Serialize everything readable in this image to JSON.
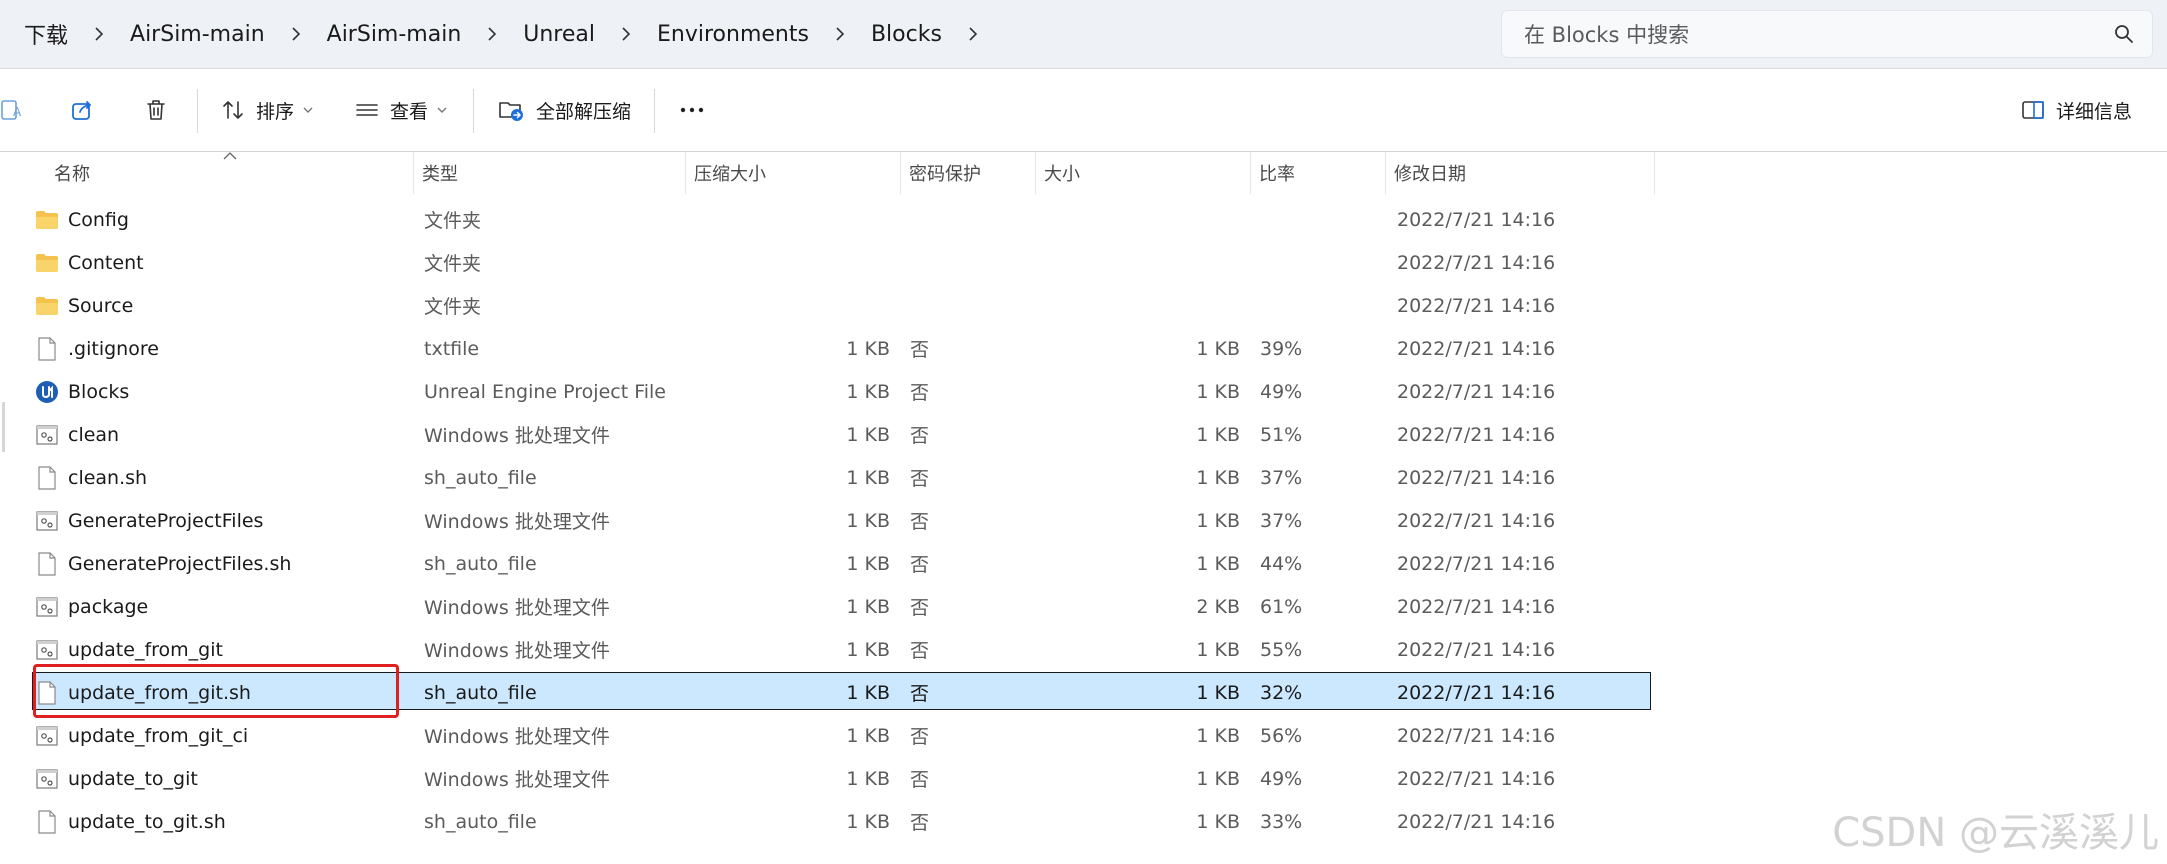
{
  "breadcrumb": [
    "下载",
    "AirSim-main",
    "AirSim-main",
    "Unreal",
    "Environments",
    "Blocks"
  ],
  "search": {
    "placeholder": "在 Blocks 中搜索"
  },
  "toolbar": {
    "sort_label": "排序",
    "view_label": "查看",
    "extract_all_label": "全部解压缩",
    "details_label": "详细信息"
  },
  "columns": {
    "name": "名称",
    "type": "类型",
    "compressed_size": "压缩大小",
    "password_protected": "密码保护",
    "size": "大小",
    "ratio": "比率",
    "modified": "修改日期"
  },
  "files": [
    {
      "icon": "folder-icon",
      "name": "Config",
      "type": "文件夹",
      "compressed_size": "",
      "password": "",
      "size": "",
      "ratio": "",
      "date": "2022/7/21 14:16"
    },
    {
      "icon": "folder-icon",
      "name": "Content",
      "type": "文件夹",
      "compressed_size": "",
      "password": "",
      "size": "",
      "ratio": "",
      "date": "2022/7/21 14:16"
    },
    {
      "icon": "folder-icon",
      "name": "Source",
      "type": "文件夹",
      "compressed_size": "",
      "password": "",
      "size": "",
      "ratio": "",
      "date": "2022/7/21 14:16"
    },
    {
      "icon": "file-icon",
      "name": ".gitignore",
      "type": "txtfile",
      "compressed_size": "1 KB",
      "password": "否",
      "size": "1 KB",
      "ratio": "39%",
      "date": "2022/7/21 14:16"
    },
    {
      "icon": "unreal-engine-icon",
      "name": "Blocks",
      "type": "Unreal Engine Project File",
      "compressed_size": "1 KB",
      "password": "否",
      "size": "1 KB",
      "ratio": "49%",
      "date": "2022/7/21 14:16"
    },
    {
      "icon": "batch-file-icon",
      "name": "clean",
      "type": "Windows 批处理文件",
      "compressed_size": "1 KB",
      "password": "否",
      "size": "1 KB",
      "ratio": "51%",
      "date": "2022/7/21 14:16"
    },
    {
      "icon": "file-icon",
      "name": "clean.sh",
      "type": "sh_auto_file",
      "compressed_size": "1 KB",
      "password": "否",
      "size": "1 KB",
      "ratio": "37%",
      "date": "2022/7/21 14:16"
    },
    {
      "icon": "batch-file-icon",
      "name": "GenerateProjectFiles",
      "type": "Windows 批处理文件",
      "compressed_size": "1 KB",
      "password": "否",
      "size": "1 KB",
      "ratio": "37%",
      "date": "2022/7/21 14:16"
    },
    {
      "icon": "file-icon",
      "name": "GenerateProjectFiles.sh",
      "type": "sh_auto_file",
      "compressed_size": "1 KB",
      "password": "否",
      "size": "1 KB",
      "ratio": "44%",
      "date": "2022/7/21 14:16"
    },
    {
      "icon": "batch-file-icon",
      "name": "package",
      "type": "Windows 批处理文件",
      "compressed_size": "1 KB",
      "password": "否",
      "size": "2 KB",
      "ratio": "61%",
      "date": "2022/7/21 14:16"
    },
    {
      "icon": "batch-file-icon",
      "name": "update_from_git",
      "type": "Windows 批处理文件",
      "compressed_size": "1 KB",
      "password": "否",
      "size": "1 KB",
      "ratio": "55%",
      "date": "2022/7/21 14:16"
    },
    {
      "icon": "file-icon",
      "name": "update_from_git.sh",
      "type": "sh_auto_file",
      "compressed_size": "1 KB",
      "password": "否",
      "size": "1 KB",
      "ratio": "32%",
      "date": "2022/7/21 14:16",
      "selected": true
    },
    {
      "icon": "batch-file-icon",
      "name": "update_from_git_ci",
      "type": "Windows 批处理文件",
      "compressed_size": "1 KB",
      "password": "否",
      "size": "1 KB",
      "ratio": "56%",
      "date": "2022/7/21 14:16"
    },
    {
      "icon": "batch-file-icon",
      "name": "update_to_git",
      "type": "Windows 批处理文件",
      "compressed_size": "1 KB",
      "password": "否",
      "size": "1 KB",
      "ratio": "49%",
      "date": "2022/7/21 14:16"
    },
    {
      "icon": "file-icon",
      "name": "update_to_git.sh",
      "type": "sh_auto_file",
      "compressed_size": "1 KB",
      "password": "否",
      "size": "1 KB",
      "ratio": "33%",
      "date": "2022/7/21 14:16"
    }
  ],
  "watermark": "CSDN @云溪溪儿",
  "colors": {
    "selection": "#cce8ff",
    "highlight_box": "#e02020",
    "folder": "#f4c24d",
    "accent": "#1e6fd9"
  }
}
